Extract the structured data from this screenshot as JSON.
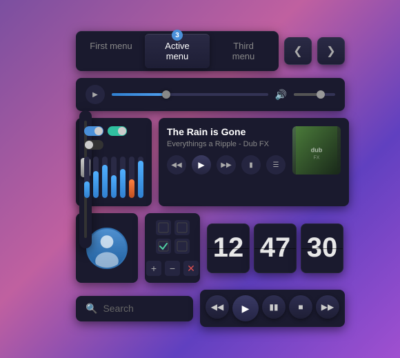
{
  "tabs": {
    "first": "First menu",
    "active": "Active menu",
    "third": "Third menu",
    "badge": "3"
  },
  "nav": {
    "prev": "‹",
    "next": "›"
  },
  "music": {
    "title": "The Rain is Gone",
    "artist": "Everythings a Ripple - Dub FX"
  },
  "flipclock": {
    "hours": "12",
    "minutes": "47",
    "seconds": "30"
  },
  "search": {
    "placeholder": "Search",
    "icon": "🔍"
  },
  "eq": {
    "bars": [
      40,
      55,
      70,
      50,
      65,
      45,
      80
    ]
  },
  "controls": {
    "prev": "⏮",
    "rewind": "⏪",
    "play": "▶",
    "pause": "⏸",
    "stop": "⏹",
    "forward": "⏭",
    "fastforward": "⏩"
  }
}
